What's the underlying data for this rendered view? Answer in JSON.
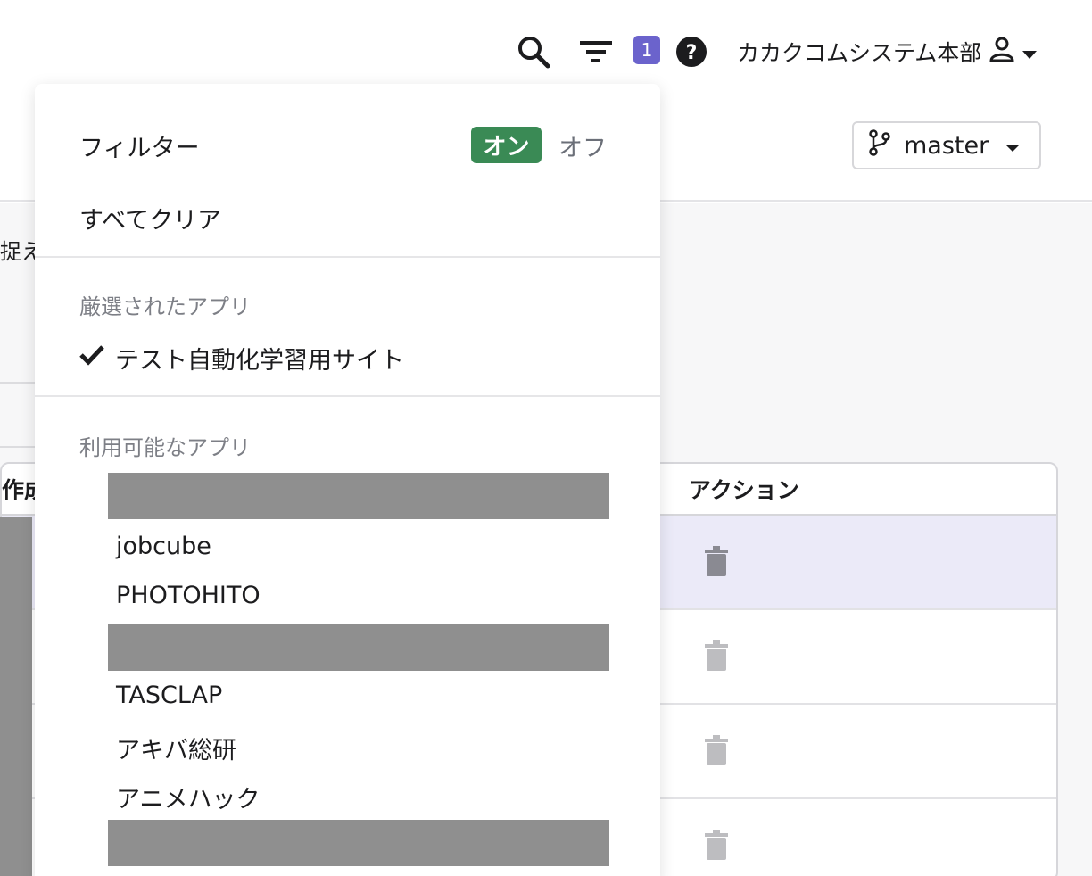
{
  "header": {
    "notification_count": "1",
    "user_name": "カカクコムシステム本部",
    "branch": "master"
  },
  "background": {
    "partial_text": "捉え",
    "table": {
      "col1_header": "作成",
      "col2_header": "アクション"
    }
  },
  "filter_panel": {
    "title": "フィルター",
    "toggle_on": "オン",
    "toggle_off": "オフ",
    "clear_all": "すべてクリア",
    "selected_section": "厳選されたアプリ",
    "selected_app": "テスト自動化学習用サイト",
    "available_section": "利用可能なアプリ",
    "available_apps": [
      "jobcube",
      "PHOTOHITO",
      "TASCLAP",
      "アキバ総研",
      "アニメハック"
    ]
  }
}
